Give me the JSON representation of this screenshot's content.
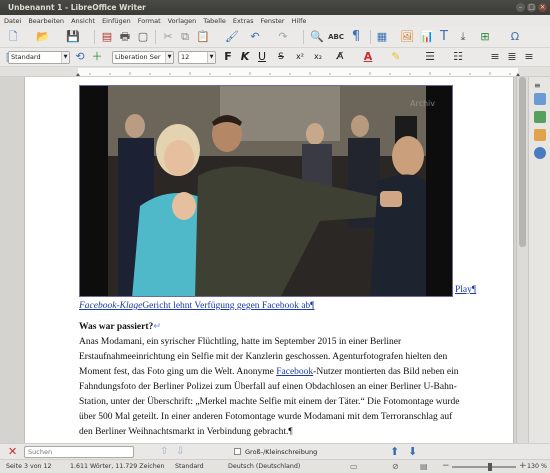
{
  "window": {
    "title": "Unbenannt 1 - LibreOffice Writer"
  },
  "menu": [
    "Datei",
    "Bearbeiten",
    "Ansicht",
    "Einfügen",
    "Format",
    "Vorlagen",
    "Tabelle",
    "Extras",
    "Fenster",
    "Hilfe"
  ],
  "format_toolbar": {
    "paragraph_style": "Standard",
    "font_name": "Liberation Ser",
    "font_size": "12",
    "bold_label": "F",
    "italic_label": "K",
    "underline_label": "U"
  },
  "document": {
    "image_link_text": "Play¶",
    "caption_link": "Facebook-Klage",
    "caption_rest": "Gericht lehnt Verfügung gegen Facebook ab¶",
    "heading": "Was war passiert?",
    "heading_mark": "↵",
    "paragraph_lines": [
      "Anas Modamani, ein syrischer Flüchtling, hatte im September 2015 in einer Berliner",
      "Erstaufnahmeeinrichtung ein Selfie mit der Kanzlerin geschossen. Agenturfotografen hielten den",
      "Moment fest, das Foto ging um die Welt. Anonyme ",
      "Fahndungsfoto der Berliner Polizei zum Überfall auf einen Obdachlosen an einer Berliner U-Bahn-",
      "Station, unter der Überschrift: „Merkel machte Selfie mit einem der Täter.“ Die Fotomontage wurde",
      "über 500 Mal geteilt. In einer anderen Fotomontage wurde Modamani mit dem Terroranschlag auf",
      "den Berliner Weihnachtsmarkt in Verbindung gebracht.¶"
    ],
    "line3_link": "Facebook",
    "line3_rest": "-Nutzer montierten das Bild neben ein"
  },
  "find_bar": {
    "search_placeholder": "Suchen",
    "match_case_label": "Groß-/Kleinschreibung"
  },
  "status_bar": {
    "page": "Seite 3 von 12",
    "words": "1.611 Wörter, 11.729 Zeichen",
    "page_style": "Standard",
    "language": "Deutsch (Deutschland)",
    "zoom": "130 %"
  },
  "colors": {
    "title_bg": "#3b3b37",
    "link": "#1a3aa8",
    "document_bg": "#d4d3cf"
  }
}
